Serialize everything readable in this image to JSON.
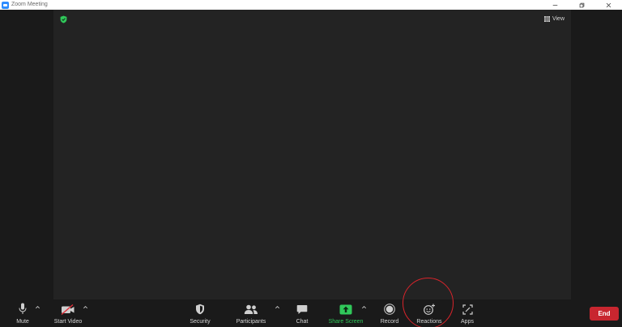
{
  "window": {
    "title": "Zoom Meeting"
  },
  "stage": {
    "view_label": "View"
  },
  "toolbar": {
    "mute_label": "Mute",
    "start_video_label": "Start Video",
    "security_label": "Security",
    "participants_label": "Participants",
    "chat_label": "Chat",
    "share_screen_label": "Share Screen",
    "record_label": "Record",
    "reactions_label": "Reactions",
    "apps_label": "Apps",
    "end_label": "End"
  },
  "icons": {
    "app_logo": "zoom-logo-icon",
    "encryption": "shield-check-icon",
    "view": "grid-icon",
    "mute": "microphone-icon",
    "video": "video-off-icon",
    "security": "shield-icon",
    "participants": "people-icon",
    "chat": "chat-bubble-icon",
    "share": "share-screen-icon",
    "record": "record-icon",
    "reactions": "smiley-plus-icon",
    "apps": "apps-icon"
  },
  "colors": {
    "accent_blue": "#2d8cff",
    "share_green": "#30c85a",
    "end_red": "#c8262f",
    "highlight_red": "#d9242b"
  }
}
